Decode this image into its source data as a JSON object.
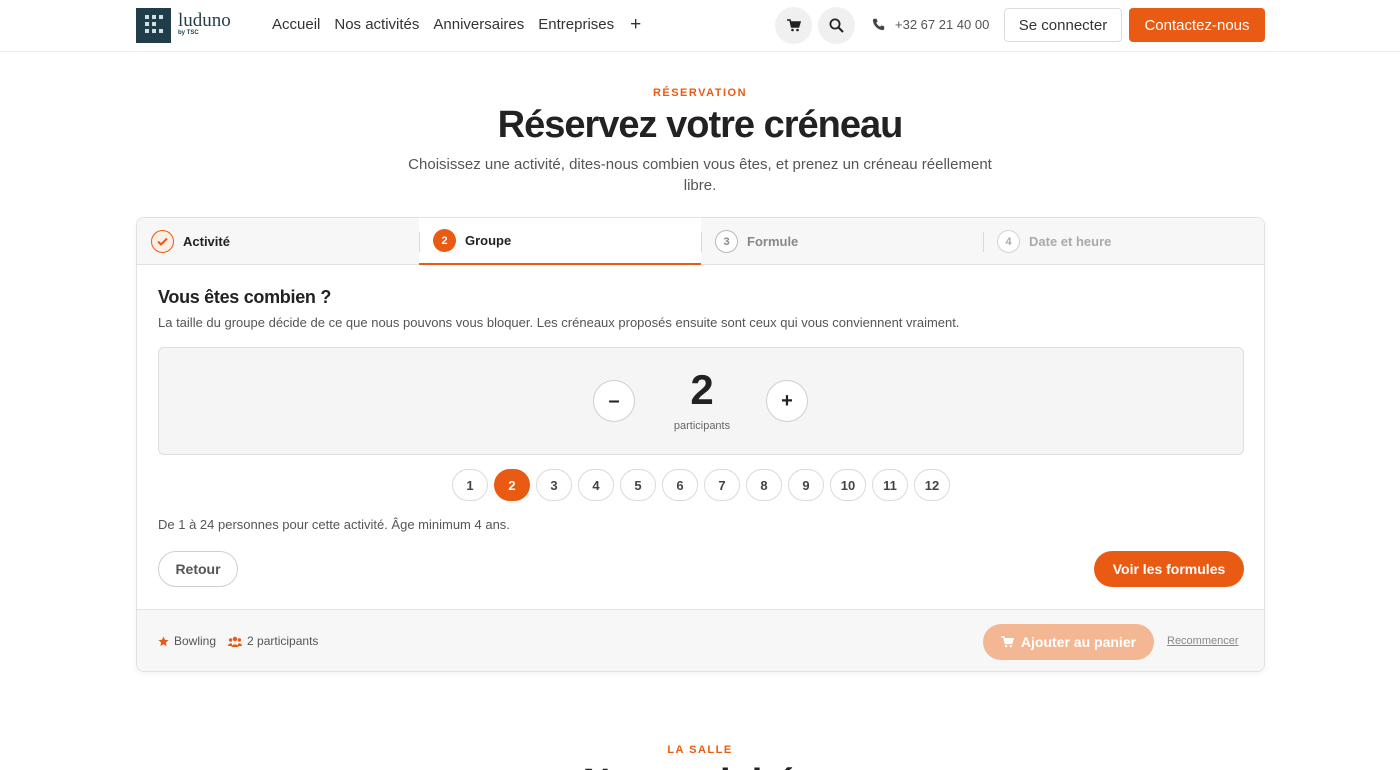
{
  "header": {
    "logo_text": "luduno",
    "logo_sub": "by TSC",
    "nav": [
      "Accueil",
      "Nos activités",
      "Anniversaires",
      "Entreprises"
    ],
    "nav_more": "+",
    "phone": "+32 67 21 40 00",
    "login": "Se connecter",
    "contact": "Contactez-nous"
  },
  "hero": {
    "eyebrow": "RÉSERVATION",
    "title": "Réservez votre créneau",
    "subtitle": "Choisissez une activité, dites-nous combien vous êtes, et prenez un créneau réellement libre."
  },
  "steps": [
    {
      "num": "✓",
      "label": "Activité",
      "state": "done"
    },
    {
      "num": "2",
      "label": "Groupe",
      "state": "current"
    },
    {
      "num": "3",
      "label": "Formule",
      "state": "todo"
    },
    {
      "num": "4",
      "label": "Date et heure",
      "state": "todo"
    }
  ],
  "group": {
    "title": "Vous êtes combien ?",
    "subtitle": "La taille du groupe décide de ce que nous pouvons vous bloquer. Les créneaux proposés ensuite sont ceux qui vous conviennent vraiment.",
    "minus": "–",
    "plus": "+",
    "count": "2",
    "count_label": "participants",
    "options": [
      "1",
      "2",
      "3",
      "4",
      "5",
      "6",
      "7",
      "8",
      "9",
      "10",
      "11",
      "12"
    ],
    "selected": "2",
    "info": "De 1 à 24 personnes pour cette activité. Âge minimum 4 ans."
  },
  "actions": {
    "back": "Retour",
    "next": "Voir les formules"
  },
  "summary": {
    "activity": "Bowling",
    "participants": "2 participants",
    "add_to_cart": "Ajouter au panier",
    "restart": "Recommencer"
  },
  "next_section": {
    "eyebrow": "LA SALLE",
    "title": "Nos activités"
  },
  "colors": {
    "accent": "#e95b13",
    "accent_disabled": "#f4b793",
    "brand_dark": "#1f3e4a"
  }
}
